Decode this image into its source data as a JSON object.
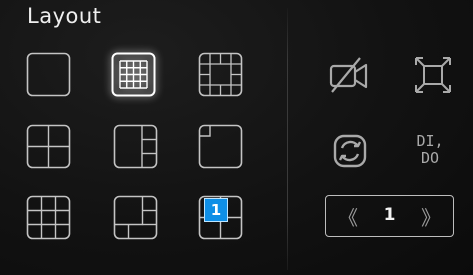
{
  "panel": {
    "title": "Layout"
  },
  "layouts": [
    {
      "name": "single",
      "selected": false
    },
    {
      "name": "grid-16",
      "selected": true
    },
    {
      "name": "grid-12-perimeter",
      "selected": false
    },
    {
      "name": "quad",
      "selected": false
    },
    {
      "name": "split-1-plus-3",
      "selected": false
    },
    {
      "name": "corner-1-plus-5",
      "selected": false
    },
    {
      "name": "grid-9",
      "selected": false
    },
    {
      "name": "big-1-plus-7",
      "selected": false
    },
    {
      "name": "quad-with-badge",
      "selected": false,
      "badge": "1"
    }
  ],
  "tools": {
    "camera_off_icon": "video-off-icon",
    "fullscreen_icon": "expand-arrows-icon",
    "refresh_icon": "sync-icon",
    "dido_label_line1": "DI,",
    "dido_label_line2": "DO"
  },
  "pager": {
    "prev_glyph": "《",
    "page": "1",
    "next_glyph": "》"
  },
  "colors": {
    "background": "#0c0c0c",
    "icon_stroke": "#bdbdbd",
    "badge": "#0f8fe6"
  }
}
